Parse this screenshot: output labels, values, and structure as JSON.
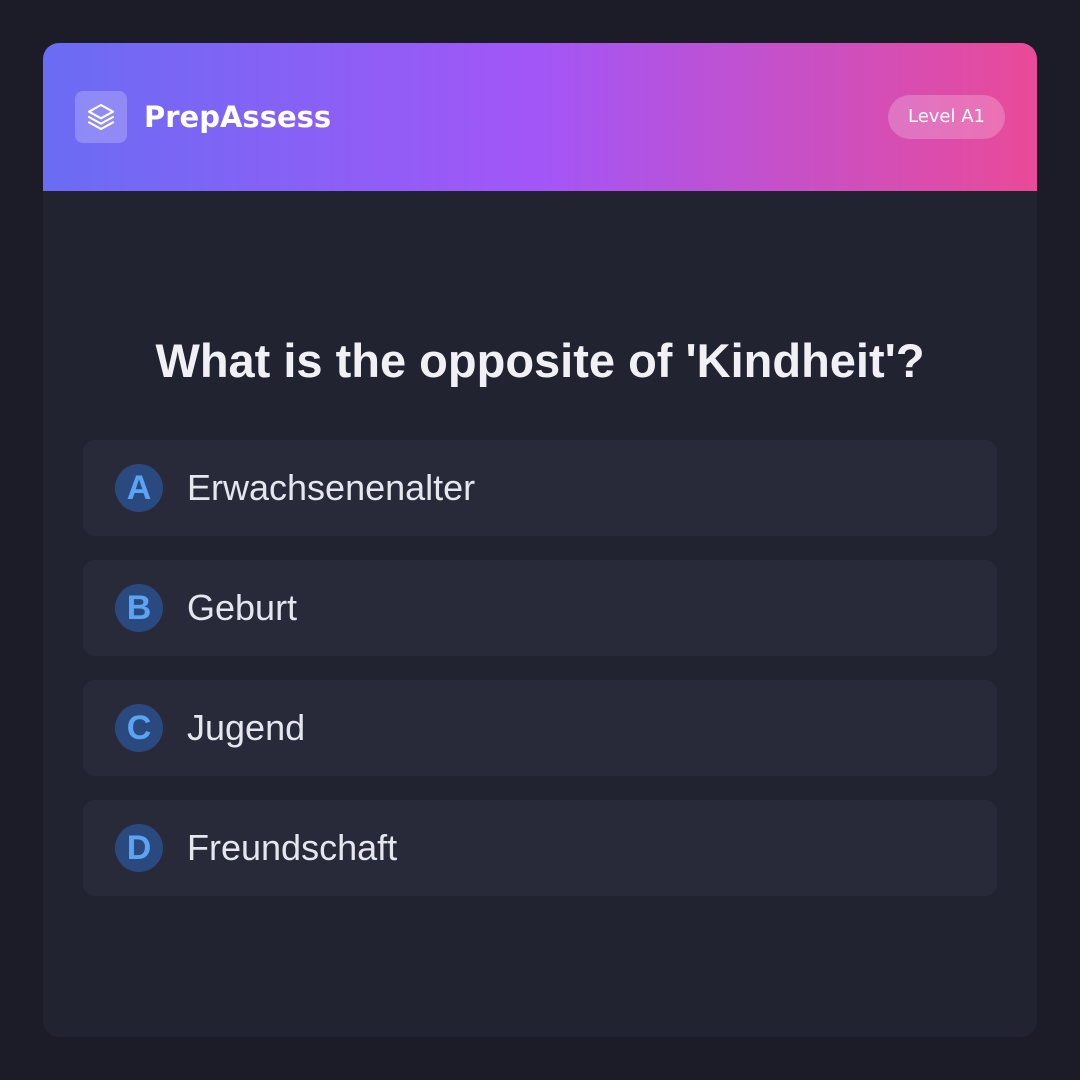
{
  "header": {
    "brand": "PrepAssess",
    "logo_icon": "layers-icon",
    "level_badge": "Level A1",
    "gradient": [
      "#6a6cf4",
      "#a356f7",
      "#ea4a98"
    ]
  },
  "question": {
    "text": "What is the opposite of 'Kindheit'?"
  },
  "options": [
    {
      "letter": "A",
      "text": "Erwachsenenalter"
    },
    {
      "letter": "B",
      "text": "Geburt"
    },
    {
      "letter": "C",
      "text": "Jugend"
    },
    {
      "letter": "D",
      "text": "Freundschaft"
    }
  ],
  "colors": {
    "background": "#1b1c28",
    "card": "#212331",
    "option": "#282a39",
    "letter_circle": "#2a4a7f",
    "letter_text": "#5aa4f3"
  }
}
